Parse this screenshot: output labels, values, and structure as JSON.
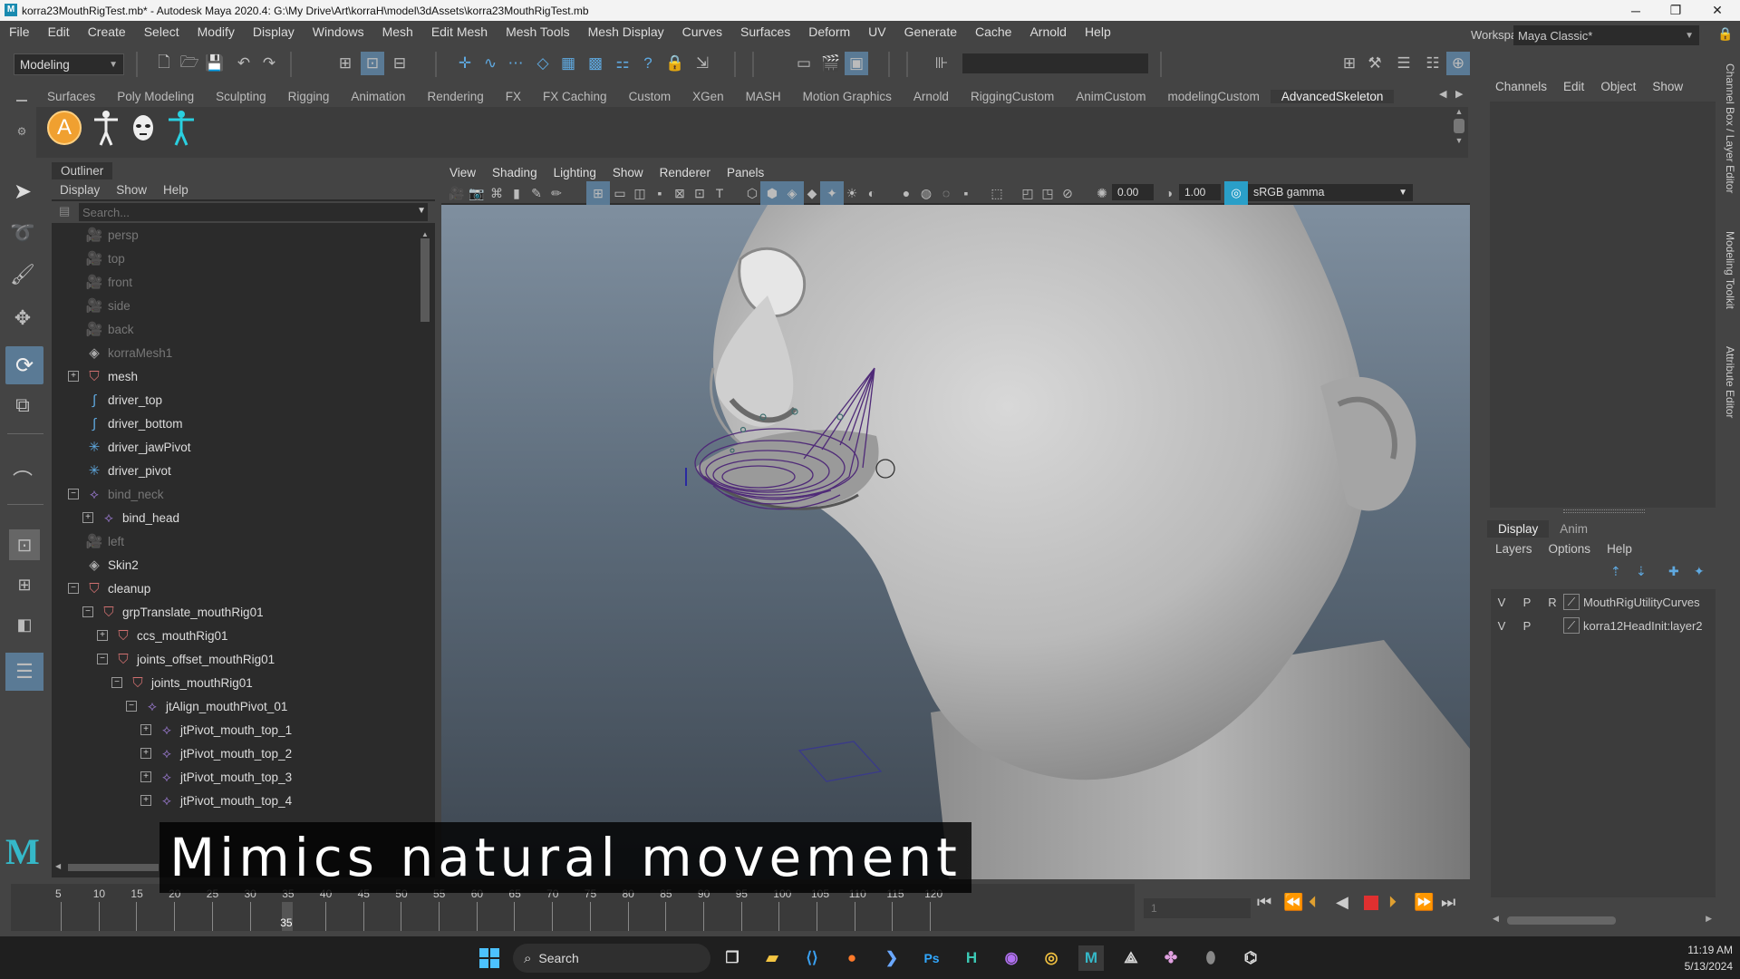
{
  "window": {
    "title": "korra23MouthRigTest.mb* - Autodesk Maya 2020.4: G:\\My Drive\\Art\\korraH\\model\\3dAssets\\korra23MouthRigTest.mb",
    "minimize_glyph": "─",
    "maximize_glyph": "❐",
    "close_glyph": "✕"
  },
  "menubar": [
    "File",
    "Edit",
    "Create",
    "Select",
    "Modify",
    "Display",
    "Windows",
    "Mesh",
    "Edit Mesh",
    "Mesh Tools",
    "Mesh Display",
    "Curves",
    "Surfaces",
    "Deform",
    "UV",
    "Generate",
    "Cache",
    "Arnold",
    "Help"
  ],
  "statusline": {
    "mode": "Modeling",
    "workspace_label": "Workspace :",
    "workspace_value": "Maya Classic*"
  },
  "shelf": {
    "tabs": [
      "Surfaces",
      "Poly Modeling",
      "Sculpting",
      "Rigging",
      "Animation",
      "Rendering",
      "FX",
      "FX Caching",
      "Custom",
      "XGen",
      "MASH",
      "Motion Graphics",
      "Arnold",
      "RiggingCustom",
      "AnimCustom",
      "modelingCustom",
      "AdvancedSkeleton"
    ],
    "active_tab": "AdvancedSkeleton",
    "button_letter": "A"
  },
  "outliner": {
    "title": "Outliner",
    "menu": [
      "Display",
      "Show",
      "Help"
    ],
    "search_placeholder": "Search...",
    "items": [
      {
        "label": "persp",
        "icon": "camera",
        "depth": 0,
        "expander": "",
        "dim": true
      },
      {
        "label": "top",
        "icon": "camera",
        "depth": 0,
        "expander": "",
        "dim": true
      },
      {
        "label": "front",
        "icon": "camera",
        "depth": 0,
        "expander": "",
        "dim": true
      },
      {
        "label": "side",
        "icon": "camera",
        "depth": 0,
        "expander": "",
        "dim": true
      },
      {
        "label": "back",
        "icon": "camera",
        "depth": 0,
        "expander": "",
        "dim": true
      },
      {
        "label": "korraMesh1",
        "icon": "mesh",
        "depth": 0,
        "expander": "",
        "dim": true
      },
      {
        "label": "mesh",
        "icon": "group",
        "depth": 0,
        "expander": "+",
        "dim": false
      },
      {
        "label": "driver_top",
        "icon": "curve",
        "depth": 0,
        "expander": "",
        "dim": false
      },
      {
        "label": "driver_bottom",
        "icon": "curve",
        "depth": 0,
        "expander": "",
        "dim": false
      },
      {
        "label": "driver_jawPivot",
        "icon": "locator",
        "depth": 0,
        "expander": "",
        "dim": false
      },
      {
        "label": "driver_pivot",
        "icon": "locator",
        "depth": 0,
        "expander": "",
        "dim": false
      },
      {
        "label": "bind_neck",
        "icon": "joint",
        "depth": 0,
        "expander": "−",
        "dim": true
      },
      {
        "label": "bind_head",
        "icon": "joint",
        "depth": 1,
        "expander": "+",
        "dim": false
      },
      {
        "label": "left",
        "icon": "camera",
        "depth": 0,
        "expander": "",
        "dim": true
      },
      {
        "label": "Skin2",
        "icon": "mesh",
        "depth": 0,
        "expander": "",
        "dim": false
      },
      {
        "label": "cleanup",
        "icon": "group",
        "depth": 0,
        "expander": "−",
        "dim": false
      },
      {
        "label": "grpTranslate_mouthRig01",
        "icon": "group",
        "depth": 1,
        "expander": "−",
        "dim": false
      },
      {
        "label": "ccs_mouthRig01",
        "icon": "group",
        "depth": 2,
        "expander": "+",
        "dim": false
      },
      {
        "label": "joints_offset_mouthRig01",
        "icon": "group",
        "depth": 2,
        "expander": "−",
        "dim": false
      },
      {
        "label": "joints_mouthRig01",
        "icon": "group",
        "depth": 3,
        "expander": "−",
        "dim": false
      },
      {
        "label": "jtAlign_mouthPivot_01",
        "icon": "joint",
        "depth": 4,
        "expander": "−",
        "dim": false
      },
      {
        "label": "jtPivot_mouth_top_1",
        "icon": "joint",
        "depth": 5,
        "expander": "+",
        "dim": false
      },
      {
        "label": "jtPivot_mouth_top_2",
        "icon": "joint",
        "depth": 5,
        "expander": "+",
        "dim": false
      },
      {
        "label": "jtPivot_mouth_top_3",
        "icon": "joint",
        "depth": 5,
        "expander": "+",
        "dim": false
      },
      {
        "label": "jtPivot_mouth_top_4",
        "icon": "joint",
        "depth": 5,
        "expander": "+",
        "dim": false
      }
    ]
  },
  "viewport": {
    "menu": [
      "View",
      "Shading",
      "Lighting",
      "Show",
      "Renderer",
      "Panels"
    ],
    "exposure": "0.00",
    "gamma": "1.00",
    "color_space": "sRGB gamma",
    "accent_color": "#4f2a78"
  },
  "channel_box": {
    "menu": [
      "Channels",
      "Edit",
      "Object",
      "Show"
    ]
  },
  "layer_editor": {
    "tabs": [
      "Display",
      "Anim"
    ],
    "menu": [
      "Layers",
      "Options",
      "Help"
    ],
    "layers": [
      {
        "v": "V",
        "p": "P",
        "r": "R",
        "name": "MouthRigUtilityCurves"
      },
      {
        "v": "V",
        "p": "P",
        "r": "",
        "name": "korra12HeadInit:layer2"
      }
    ]
  },
  "side_tabs": [
    "Channel Box / Layer Editor",
    "Modeling Toolkit",
    "Attribute Editor"
  ],
  "timeline": {
    "ticks": [
      "5",
      "10",
      "15",
      "20",
      "25",
      "30",
      "35",
      "40",
      "45",
      "50",
      "55",
      "60",
      "65",
      "70",
      "75",
      "80",
      "85",
      "90",
      "95",
      "100",
      "105",
      "110",
      "115",
      "120"
    ],
    "current_frame": "35",
    "frame_field": "1"
  },
  "caption": "Mimics natural movement",
  "taskbar": {
    "search_label": "Search",
    "time": "11:19 AM",
    "date": "5/13/2024"
  }
}
